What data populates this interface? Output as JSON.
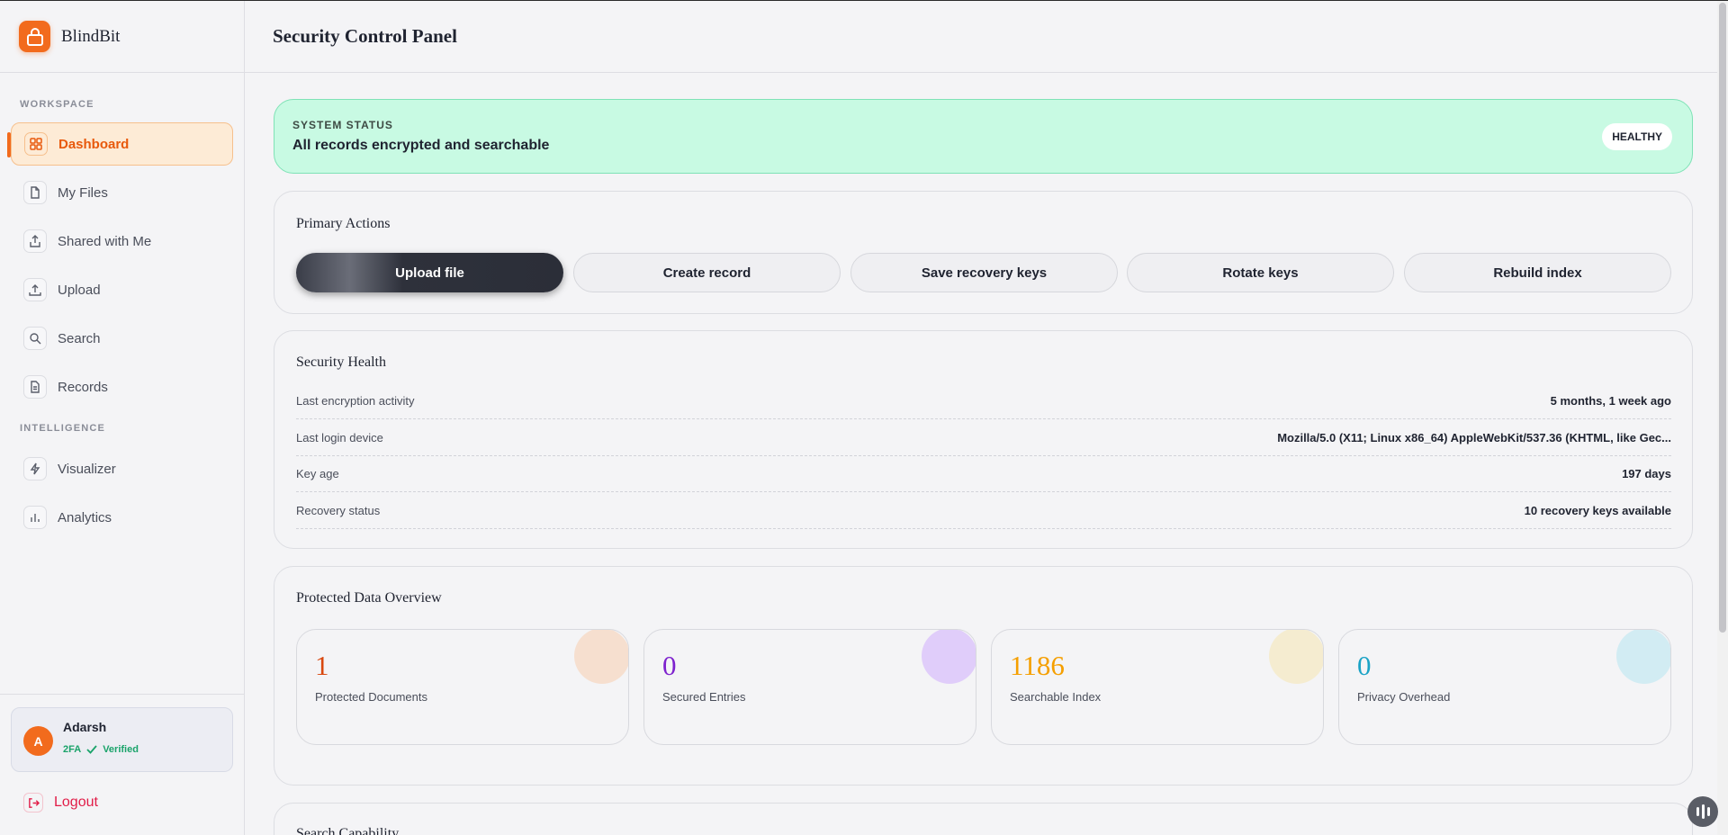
{
  "brand": {
    "name": "BlindBit",
    "icon": "lock-icon",
    "color": "#f26b1d"
  },
  "sidebar": {
    "sections": [
      "WORKSPACE",
      "INTELLIGENCE"
    ],
    "items": [
      {
        "label": "Dashboard",
        "icon": "grid-icon",
        "active": true
      },
      {
        "label": "My Files",
        "icon": "file-icon"
      },
      {
        "label": "Shared with Me",
        "icon": "share-icon"
      },
      {
        "label": "Upload",
        "icon": "upload-icon"
      },
      {
        "label": "Search",
        "icon": "search-icon"
      },
      {
        "label": "Records",
        "icon": "document-icon"
      },
      {
        "label": "Visualizer",
        "icon": "bolt-icon"
      },
      {
        "label": "Analytics",
        "icon": "bar-chart-icon"
      }
    ]
  },
  "user": {
    "initial": "A",
    "name": "Adarsh",
    "twofa": "2FA",
    "verified": "Verified"
  },
  "logout": {
    "label": "Logout"
  },
  "header": {
    "title": "Security Control Panel"
  },
  "status": {
    "label": "SYSTEM STATUS",
    "text": "All records encrypted and searchable",
    "badge": "HEALTHY",
    "color": "#c8fae3"
  },
  "actions": {
    "title": "Primary Actions",
    "buttons": [
      "Upload file",
      "Create record",
      "Save recovery keys",
      "Rotate keys",
      "Rebuild index"
    ]
  },
  "health": {
    "title": "Security Health",
    "rows": [
      {
        "key": "Last encryption activity",
        "value": "5 months, 1 week ago"
      },
      {
        "key": "Last login device",
        "value": "Mozilla/5.0 (X11; Linux x86_64) AppleWebKit/537.36 (KHTML, like Gec..."
      },
      {
        "key": "Key age",
        "value": "197 days"
      },
      {
        "key": "Recovery status",
        "value": "10 recovery keys available"
      }
    ]
  },
  "overview": {
    "title": "Protected Data Overview",
    "stats": [
      {
        "value": "1",
        "label": "Protected Documents",
        "color": "#d9480f",
        "blob": "#f6dfcf"
      },
      {
        "value": "0",
        "label": "Secured Entries",
        "color": "#7e22ce",
        "blob": "#e0cdfa"
      },
      {
        "value": "1186",
        "label": "Searchable Index",
        "color": "#f59f00",
        "blob": "#f5ecd0"
      },
      {
        "value": "0",
        "label": "Privacy Overhead",
        "color": "#1ba3c6",
        "blob": "#d2ecf3"
      }
    ]
  },
  "search_capability": {
    "title": "Search Capability"
  }
}
